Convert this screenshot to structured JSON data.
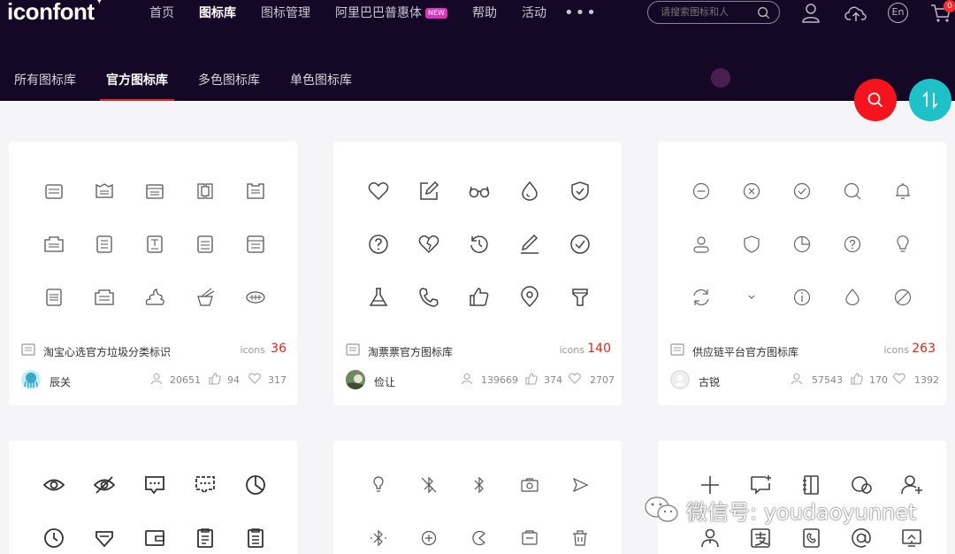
{
  "logo": {
    "text": "iconfont",
    "mark": "✦"
  },
  "nav": {
    "items": [
      {
        "label": "首页"
      },
      {
        "label": "图标库"
      },
      {
        "label": "图标管理"
      },
      {
        "label": "阿里巴巴普惠体",
        "badge": "NEW"
      },
      {
        "label": "帮助"
      },
      {
        "label": "活动"
      }
    ],
    "more": "•••"
  },
  "search": {
    "placeholder": "请搜索图标和人"
  },
  "header_icons": {
    "cart_count": "0",
    "lang": "En"
  },
  "subnav": {
    "items": [
      {
        "label": "所有图标库"
      },
      {
        "label": "官方图标库"
      },
      {
        "label": "多色图标库"
      },
      {
        "label": "单色图标库"
      }
    ]
  },
  "cards": [
    {
      "title": "淘宝心选官方垃圾分类标识",
      "icons_label": "icons",
      "count": "36",
      "author": "辰关",
      "views": "20651",
      "likes": "94",
      "favorites": "317"
    },
    {
      "title": "淘票票官方图标库",
      "icons_label": "icons",
      "count": "140",
      "author": "俭让",
      "views": "139669",
      "likes": "374",
      "favorites": "2707"
    },
    {
      "title": "供应链平台官方图标库",
      "icons_label": "icons",
      "count": "263",
      "author": "古锐",
      "views": "57543",
      "likes": "170",
      "favorites": "1392"
    }
  ],
  "watermark": {
    "text": "微信号: youdaoyunnet"
  },
  "colors": {
    "header_bg": "#150826",
    "accent_red": "#e3261f",
    "fab_search": "#f5141e",
    "fab_sort": "#1ec1c8"
  }
}
